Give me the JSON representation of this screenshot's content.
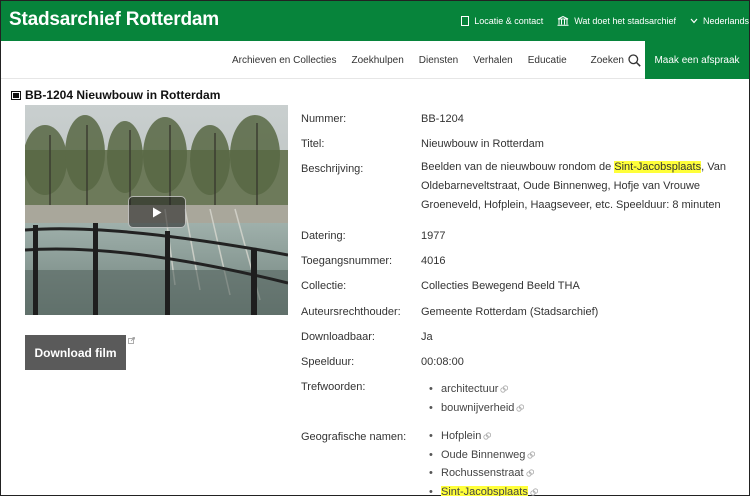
{
  "header": {
    "brand": "Stadsarchief Rotterdam",
    "links": [
      {
        "label": "Locatie & contact",
        "icon": "location-icon"
      },
      {
        "label": "Wat doet het stadsarchief",
        "icon": "building-icon"
      },
      {
        "label": "Nederlands",
        "icon": "chevron-down-icon"
      }
    ],
    "color": "#07843b"
  },
  "nav": {
    "items": [
      "Archieven en Collecties",
      "Zoekhulpen",
      "Diensten",
      "Verhalen",
      "Educatie"
    ],
    "search_label": "Zoeken",
    "cta_label": "Maak een afspraak"
  },
  "page": {
    "title": "BB-1204 Nieuwbouw in Rotterdam",
    "download_label": "Download film"
  },
  "details": {
    "nummer_label": "Nummer:",
    "nummer": "BB-1204",
    "titel_label": "Titel:",
    "titel": "Nieuwbouw in Rotterdam",
    "beschrijving_label": "Beschrijving:",
    "beschrijving_pre": "Beelden van de nieuwbouw rondom de ",
    "beschrijving_highlight": "Sint-Jacobsplaats",
    "beschrijving_post": ", Van Oldebarneveltstraat, Oude Binnenweg, Hofje van Vrouwe Groeneveld, Hofplein, Haagseveer, etc. Speelduur: 8 minuten",
    "datering_label": "Datering:",
    "datering": "1977",
    "toegang_label": "Toegangsnummer:",
    "toegang": "4016",
    "collectie_label": "Collectie:",
    "collectie": "Collecties Bewegend Beeld THA",
    "auteurs_label": "Auteursrechthouder:",
    "auteurs": "Gemeente Rotterdam (Stadsarchief)",
    "downloadbaar_label": "Downloadbaar:",
    "downloadbaar": "Ja",
    "speelduur_label": "Speelduur:",
    "speelduur": "00:08:00",
    "trefwoorden_label": "Trefwoorden:",
    "trefwoorden": [
      "architectuur",
      "bouwnijverheid"
    ],
    "geo_label": "Geografische namen:",
    "geo": [
      "Hofplein",
      "Oude Binnenweg",
      "Rochussenstraat",
      "Sint-Jacobsplaats"
    ],
    "highlight_color": "#ffff3a"
  }
}
